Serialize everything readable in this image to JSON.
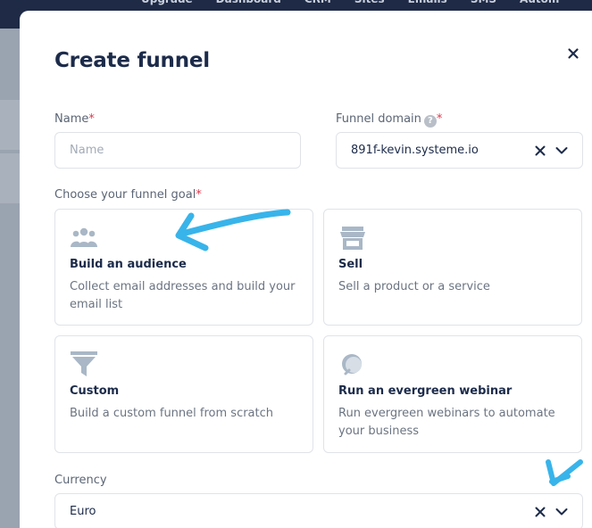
{
  "background": {
    "nav_items": [
      "Upgrade",
      "Dashboard",
      "CRM",
      "Sites",
      "Emails",
      "SMS",
      "Autom"
    ]
  },
  "modal": {
    "title": "Create funnel",
    "name_field": {
      "label": "Name",
      "required_mark": "*",
      "value": "",
      "placeholder": "Name"
    },
    "domain_field": {
      "label": "Funnel domain",
      "help_glyph": "?",
      "required_mark": "*",
      "value": "891f-kevin.systeme.io"
    },
    "goal": {
      "label": "Choose your funnel goal",
      "required_mark": "*",
      "options": [
        {
          "id": "audience",
          "icon": "people-group-icon",
          "title": "Build an audience",
          "description": "Collect email addresses and build your email list"
        },
        {
          "id": "sell",
          "icon": "storefront-icon",
          "title": "Sell",
          "description": "Sell a product or a service"
        },
        {
          "id": "custom",
          "icon": "funnel-icon",
          "title": "Custom",
          "description": "Build a custom funnel from scratch"
        },
        {
          "id": "webinar",
          "icon": "headset-icon",
          "title": "Run an evergreen webinar",
          "description": "Run evergreen webinars to automate your business"
        }
      ]
    },
    "currency_field": {
      "label": "Currency",
      "value": "Euro"
    }
  },
  "colors": {
    "title": "#1c2b4a",
    "required": "#e0384c",
    "icon": "#a9b7c6",
    "annotation": "#38b4ea"
  }
}
